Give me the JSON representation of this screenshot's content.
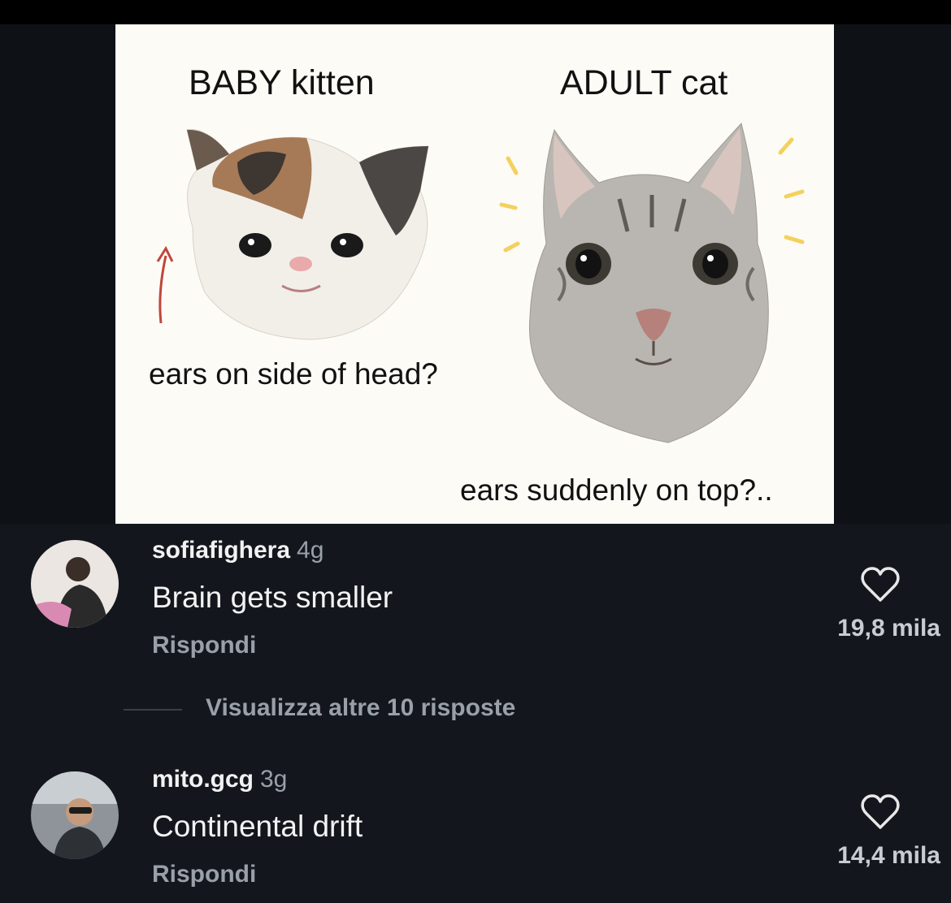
{
  "meme": {
    "baby_caption": "BABY kitten",
    "adult_caption": "ADULT cat",
    "side_caption": "ears on side of head?",
    "top_caption": "ears suddenly on top?.."
  },
  "comments": [
    {
      "username": "sofiafighera",
      "age": "4g",
      "text": "Brain gets smaller",
      "reply_label": "Rispondi",
      "like_count": "19,8 mila"
    },
    {
      "username": "mito.gcg",
      "age": "3g",
      "text": "Continental drift",
      "reply_label": "Rispondi",
      "like_count": "14,4 mila"
    }
  ],
  "view_more_replies": "Visualizza altre 10 risposte",
  "colors": {
    "background": "#13171d",
    "text_primary": "#f2f2f2",
    "text_secondary": "#9aa0a8"
  },
  "icons": {
    "like": "heart-outline-icon"
  }
}
